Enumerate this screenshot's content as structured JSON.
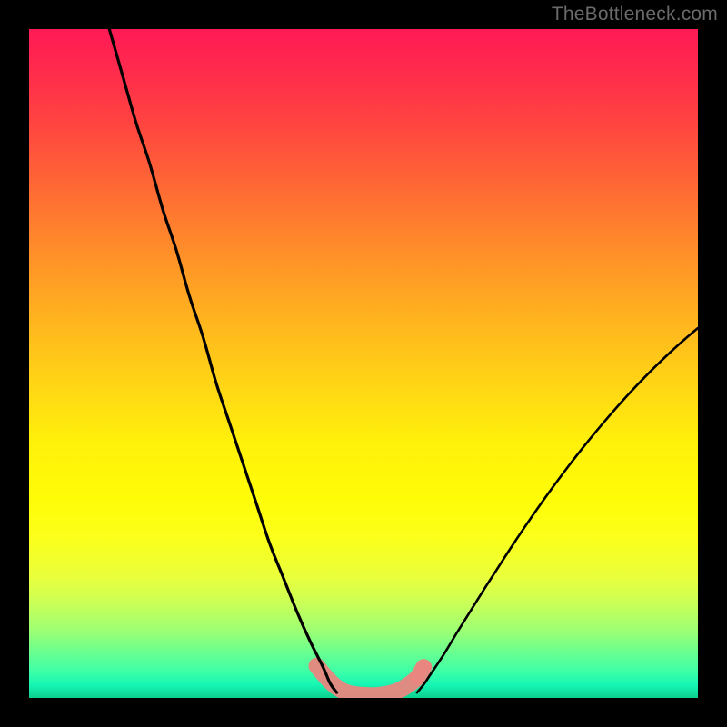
{
  "watermark": {
    "text": "TheBottleneck.com"
  },
  "chart_data": {
    "type": "line",
    "title": "",
    "xlabel": "",
    "ylabel": "",
    "xlim": [
      0,
      100
    ],
    "ylim": [
      0,
      100
    ],
    "series": [
      {
        "name": "left-curve",
        "x": [
          12,
          14,
          16,
          18,
          20,
          22,
          24,
          26,
          28,
          30,
          32,
          34,
          36,
          38,
          40,
          42,
          44,
          45,
          46
        ],
        "y": [
          100,
          93,
          86,
          80,
          73,
          67,
          60,
          54,
          47,
          41,
          35,
          29,
          23,
          18,
          13,
          8.5,
          4.5,
          2.2,
          0.8
        ]
      },
      {
        "name": "right-curve",
        "x": [
          58,
          59,
          60,
          62,
          64,
          66,
          68,
          70,
          72,
          74,
          76,
          78,
          80,
          82,
          84,
          86,
          88,
          90,
          92,
          94,
          96,
          98,
          100
        ],
        "y": [
          0.8,
          2.0,
          3.5,
          6.5,
          9.8,
          13.0,
          16.2,
          19.3,
          22.4,
          25.4,
          28.3,
          31.1,
          33.8,
          36.4,
          38.9,
          41.3,
          43.6,
          45.8,
          47.9,
          49.9,
          51.8,
          53.6,
          55.3
        ]
      },
      {
        "name": "trough-marker",
        "x": [
          43,
          44.5,
          46,
          47.5,
          49,
          50.5,
          52,
          53.5,
          55,
          56.5,
          58,
          59
        ],
        "y": [
          4.8,
          3.0,
          1.6,
          0.8,
          0.5,
          0.4,
          0.4,
          0.6,
          1.0,
          1.8,
          3.0,
          4.6
        ]
      }
    ],
    "gradient_stops": [
      {
        "pos": 0,
        "color": "#ff1a55"
      },
      {
        "pos": 6,
        "color": "#ff2a4d"
      },
      {
        "pos": 14,
        "color": "#ff4440"
      },
      {
        "pos": 24,
        "color": "#ff6a34"
      },
      {
        "pos": 34,
        "color": "#ff9128"
      },
      {
        "pos": 44,
        "color": "#ffb61e"
      },
      {
        "pos": 54,
        "color": "#ffd814"
      },
      {
        "pos": 62,
        "color": "#fff10a"
      },
      {
        "pos": 70,
        "color": "#fffc07"
      },
      {
        "pos": 76,
        "color": "#fbff1a"
      },
      {
        "pos": 82,
        "color": "#e9ff3c"
      },
      {
        "pos": 86,
        "color": "#c8ff58"
      },
      {
        "pos": 90,
        "color": "#9cff74"
      },
      {
        "pos": 93,
        "color": "#6cff8e"
      },
      {
        "pos": 96,
        "color": "#3effa6"
      },
      {
        "pos": 98,
        "color": "#17f7b4"
      },
      {
        "pos": 100,
        "color": "#0ccf8e"
      }
    ],
    "styles": {
      "curve_stroke": "#000000",
      "curve_width_left": 3.2,
      "curve_width_right": 2.6,
      "marker_color": "#e9867f",
      "marker_radius": 9
    }
  }
}
